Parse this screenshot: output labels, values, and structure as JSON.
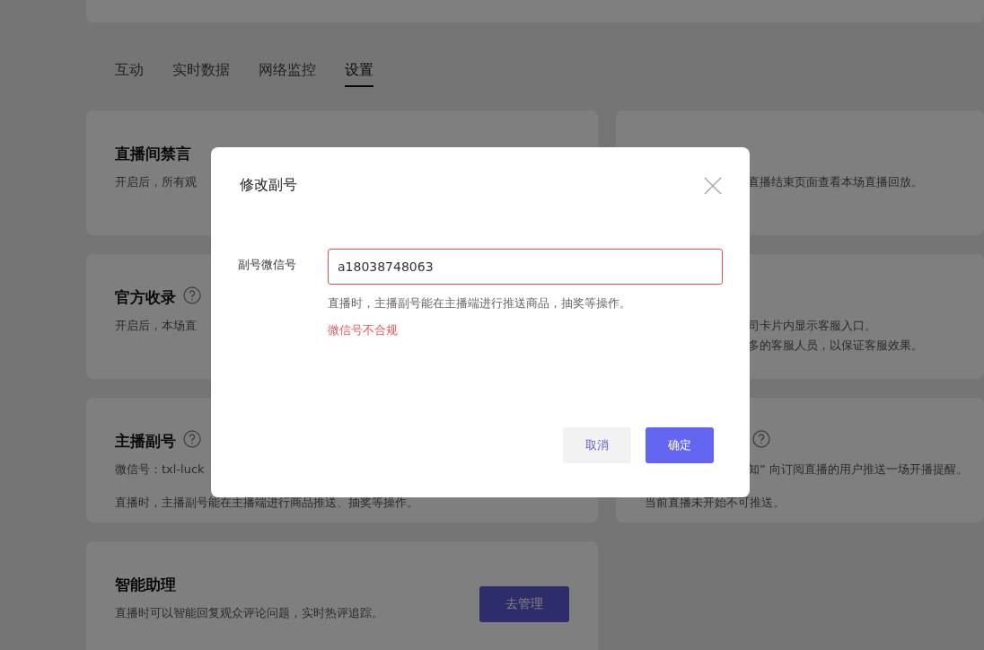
{
  "tabs": [
    {
      "label": "互动",
      "selected": false
    },
    {
      "label": "实时数据",
      "selected": false
    },
    {
      "label": "网络监控",
      "selected": false
    },
    {
      "label": "设置",
      "selected": true
    }
  ],
  "left_cards": [
    {
      "title": "直播间禁言",
      "help": false,
      "lines": [
        "开启后，所有观"
      ]
    },
    {
      "title": "官方收录",
      "help": true,
      "lines": [
        "开启后，本场直"
      ]
    },
    {
      "title": "主播副号",
      "help": true,
      "lines": [
        "微信号：txl-luck",
        "直播时，主播副号能在主播端进行商品推送、抽奖等操作。"
      ]
    },
    {
      "title": "智能助理",
      "help": false,
      "lines": [
        "直播时可以智能回复观众评论问题，实时热评追踪。"
      ],
      "button": "去管理"
    }
  ],
  "right_cards": [
    {
      "lines": [
        {
          "text": "直播结束页面查看本场直播回放。",
          "partly_covered": true
        }
      ]
    },
    {
      "lines": [
        {
          "text": "司卡片内显示客服入口。",
          "partly_covered": true
        },
        {
          "text": "多的客服人员，以保证客服效果。",
          "partly_covered": true
        }
      ]
    },
    {
      "help": true,
      "lines": [
        {
          "text": "知” 向订阅直播的用户推送一场开播提醒。",
          "partly_covered": true
        },
        {
          "text": "当前直播未开始不可推送。",
          "partly_covered": false
        }
      ]
    }
  ],
  "dialog": {
    "title": "修改副号",
    "field_label": "副号微信号",
    "value": "a18038748063",
    "invalid": true,
    "hint": "直播时，主播副号能在主播端进行推送商品，抽奖等操作。",
    "error": "微信号不合规",
    "buttons": [
      {
        "label": "取消",
        "kind": "secondary"
      },
      {
        "label": "确定",
        "kind": "primary"
      }
    ]
  }
}
